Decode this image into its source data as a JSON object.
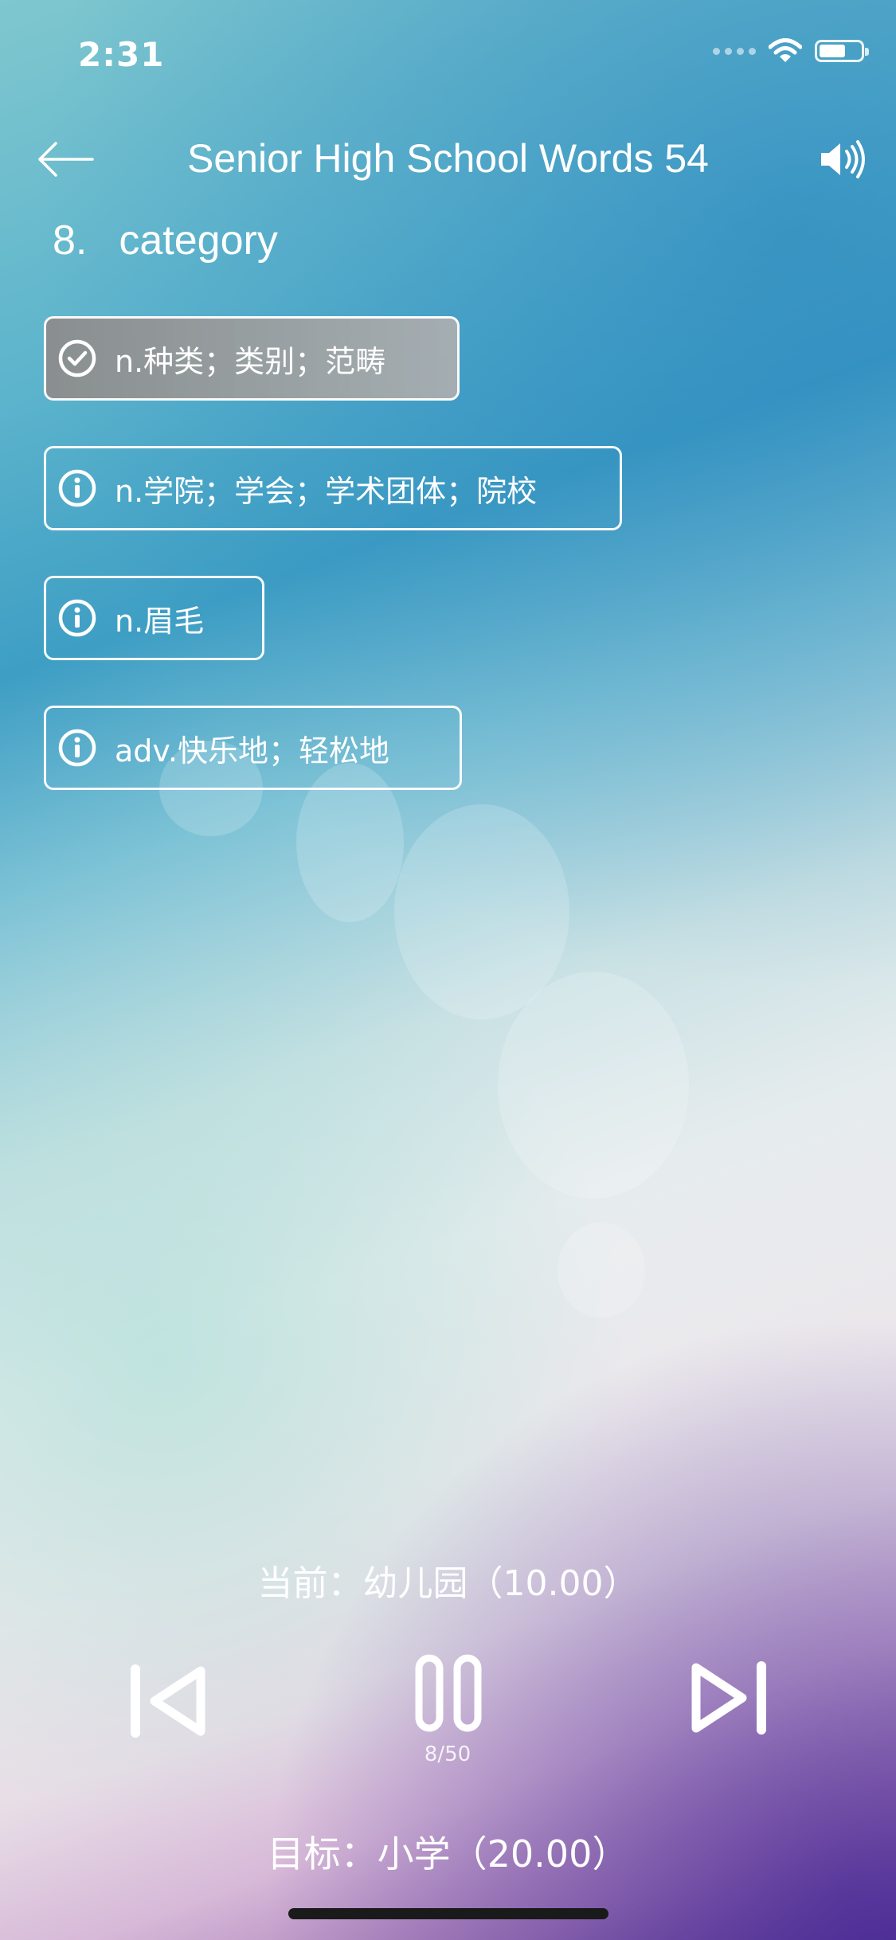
{
  "status_bar": {
    "time": "2:31"
  },
  "nav": {
    "title": "Senior High School Words 54"
  },
  "question": {
    "number": "8.",
    "word": "category"
  },
  "options": [
    {
      "text": "n.种类；类别；范畴",
      "state": "selected",
      "icon": "check-circle-icon"
    },
    {
      "text": "n.学院；学会；学术团体；院校",
      "state": "unselected",
      "icon": "info-circle-icon"
    },
    {
      "text": "n.眉毛",
      "state": "unselected",
      "icon": "info-circle-icon"
    },
    {
      "text": "adv.快乐地；轻松地",
      "state": "unselected",
      "icon": "info-circle-icon"
    }
  ],
  "footer": {
    "current": "当前：幼儿园（10.00）",
    "progress": "8/50",
    "target": "目标：小学（20.00）"
  }
}
